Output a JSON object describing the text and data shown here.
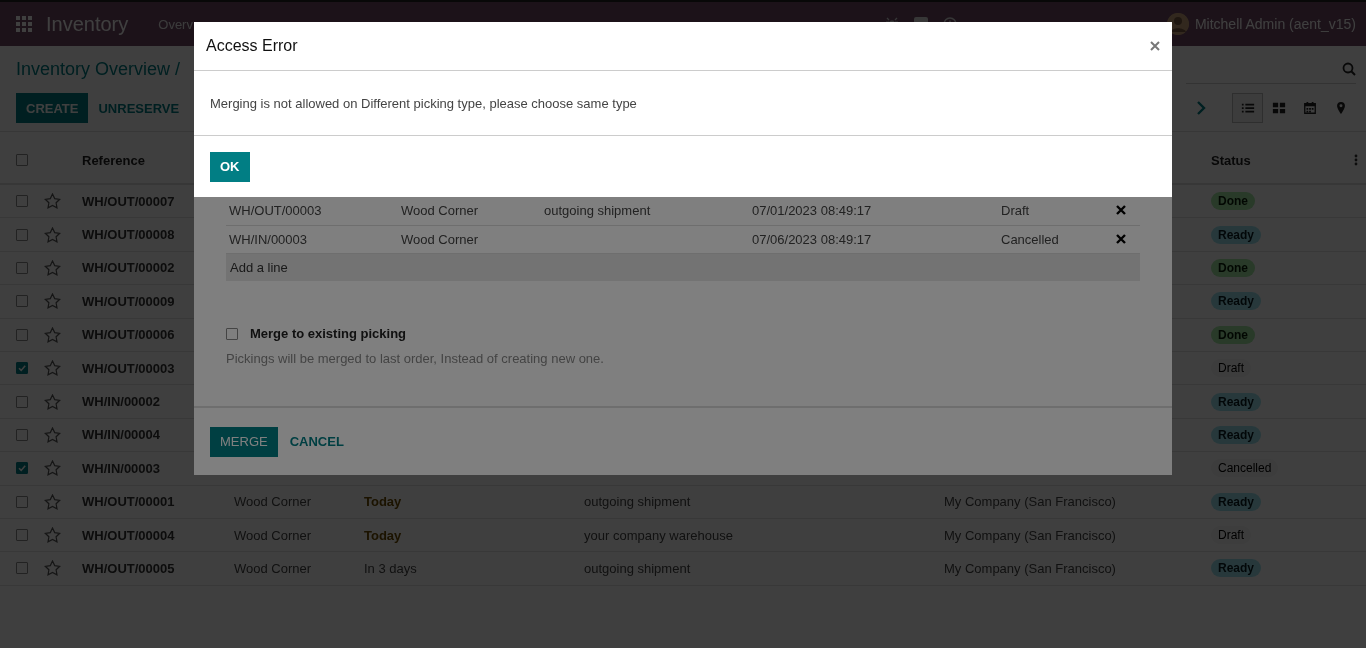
{
  "navbar": {
    "app_name": "Inventory",
    "menu": [
      "Overv"
    ],
    "user": "Mitchell Admin (aent_v15)"
  },
  "control_panel": {
    "breadcrumb": "Inventory Overview /",
    "buttons": [
      {
        "label": "CREATE",
        "kind": "primary"
      },
      {
        "label": "UNRESERVE",
        "kind": "link"
      }
    ],
    "views": [
      {
        "kind": "list",
        "selected": true
      },
      {
        "kind": "kanban",
        "selected": false
      },
      {
        "kind": "calendar",
        "selected": false
      },
      {
        "kind": "map",
        "selected": false
      }
    ]
  },
  "list": {
    "select_all": {
      "checked": false
    },
    "columns": [
      "Reference",
      "Status"
    ],
    "rows": [
      {
        "checked": false,
        "starred": false,
        "reference": "WH/OUT/00007",
        "status": {
          "label": "Done",
          "kind": "done"
        }
      },
      {
        "checked": false,
        "starred": false,
        "reference": "WH/OUT/00008",
        "status": {
          "label": "Ready",
          "kind": "ready"
        }
      },
      {
        "checked": false,
        "starred": false,
        "reference": "WH/OUT/00002",
        "status": {
          "label": "Done",
          "kind": "done"
        }
      },
      {
        "checked": false,
        "starred": false,
        "reference": "WH/OUT/00009",
        "status": {
          "label": "Ready",
          "kind": "ready"
        }
      },
      {
        "checked": false,
        "starred": false,
        "reference": "WH/OUT/00006",
        "status": {
          "label": "Done",
          "kind": "done"
        }
      },
      {
        "checked": true,
        "starred": false,
        "reference": "WH/OUT/00003",
        "status": {
          "label": "Draft",
          "kind": "draft"
        }
      },
      {
        "checked": false,
        "starred": false,
        "reference": "WH/IN/00002",
        "status": {
          "label": "Ready",
          "kind": "ready"
        }
      },
      {
        "checked": false,
        "starred": false,
        "reference": "WH/IN/00004",
        "status": {
          "label": "Ready",
          "kind": "ready"
        }
      },
      {
        "checked": true,
        "starred": false,
        "reference": "WH/IN/00003",
        "status": {
          "label": "Cancelled",
          "kind": "cancelled"
        }
      },
      {
        "checked": false,
        "starred": false,
        "reference": "WH/OUT/00001",
        "contact": "Wood Corner",
        "scheduled_date": {
          "text": "Today",
          "due_today": true
        },
        "source": "outgoing shipment",
        "company": "My Company (San Francisco)",
        "status": {
          "label": "Ready",
          "kind": "ready"
        }
      },
      {
        "checked": false,
        "starred": false,
        "reference": "WH/OUT/00004",
        "contact": "Wood Corner",
        "scheduled_date": {
          "text": "Today",
          "due_today": true
        },
        "source": "your company warehouse",
        "company": "My Company (San Francisco)",
        "status": {
          "label": "Draft",
          "kind": "draft"
        }
      },
      {
        "checked": false,
        "starred": false,
        "reference": "WH/OUT/00005",
        "contact": "Wood Corner",
        "scheduled_date": {
          "text": "In 3 days",
          "due_today": false
        },
        "source": "outgoing shipment",
        "company": "My Company (San Francisco)",
        "status": {
          "label": "Ready",
          "kind": "ready"
        }
      }
    ]
  },
  "merge_dialog": {
    "lines": [
      {
        "reference": "WH/OUT/00003",
        "partner": "Wood Corner",
        "source": "outgoing shipment",
        "date": "07/01/2023 08:49:17",
        "state": "Draft"
      },
      {
        "reference": "WH/IN/00003",
        "partner": "Wood Corner",
        "date": "07/06/2023 08:49:17",
        "state": "Cancelled"
      }
    ],
    "add_line": "Add a line",
    "merge_existing": {
      "label": "Merge to existing picking",
      "checked": false
    },
    "help": "Pickings will be merged to last order, Instead of creating new one.",
    "buttons": [
      {
        "label": "MERGE",
        "kind": "primary"
      },
      {
        "label": "CANCEL",
        "kind": "link"
      }
    ]
  },
  "error_dialog": {
    "title": "Access Error",
    "message": "Merging is not allowed on Different picking type, please choose same type",
    "button": "OK"
  }
}
